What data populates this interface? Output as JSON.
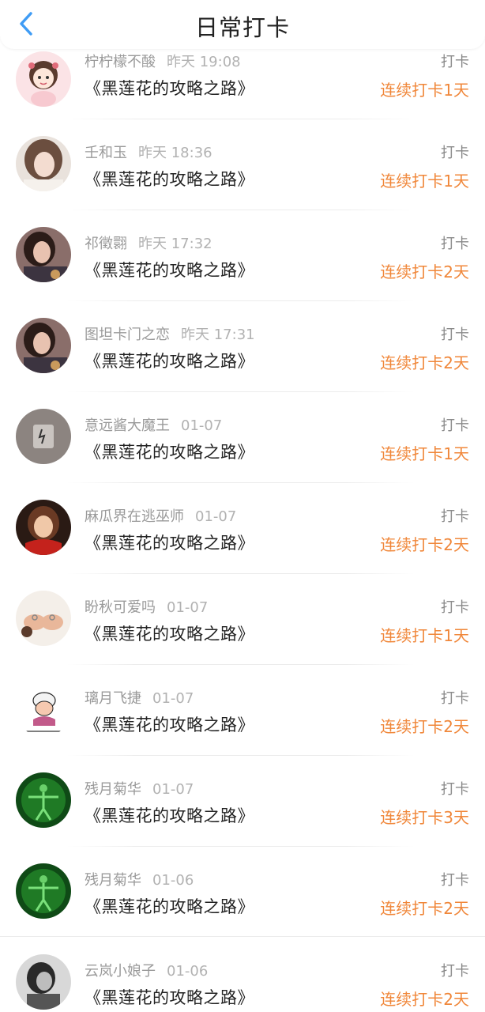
{
  "header": {
    "title": "日常打卡",
    "back_icon": "chevron-left-icon",
    "accent_color": "#3f9cf5"
  },
  "colors": {
    "streak": "#f0873a",
    "name": "#9a9a9a",
    "book": "#222222"
  },
  "entries": [
    {
      "user": "柠柠檬不酸",
      "time": "昨天 19:08",
      "book": "《黑莲花的攻略之路》",
      "type": "打卡",
      "streak": "连续打卡1天",
      "avatar": "cartoon-girl-avatar"
    },
    {
      "user": "壬和玉",
      "time": "昨天 18:36",
      "book": "《黑莲花的攻略之路》",
      "type": "打卡",
      "streak": "连续打卡1天",
      "avatar": "girl-photo-avatar"
    },
    {
      "user": "祁徵翾",
      "time": "昨天 17:32",
      "book": "《黑莲花的攻略之路》",
      "type": "打卡",
      "streak": "连续打卡2天",
      "avatar": "woman-portrait-avatar"
    },
    {
      "user": "图坦卡门之恋",
      "time": "昨天 17:31",
      "book": "《黑莲花的攻略之路》",
      "type": "打卡",
      "streak": "连续打卡2天",
      "avatar": "woman-portrait-avatar"
    },
    {
      "user": "意远酱大魔王",
      "time": "01-07",
      "book": "《黑莲花的攻略之路》",
      "type": "打卡",
      "streak": "连续打卡1天",
      "avatar": "gray-object-avatar"
    },
    {
      "user": "麻瓜界在逃巫师",
      "time": "01-07",
      "book": "《黑莲花的攻略之路》",
      "type": "打卡",
      "streak": "连续打卡2天",
      "avatar": "girl-red-scarf-avatar"
    },
    {
      "user": "盼秋可爱吗",
      "time": "01-07",
      "book": "《黑莲花的攻略之路》",
      "type": "打卡",
      "streak": "连续打卡1天",
      "avatar": "hands-rings-avatar"
    },
    {
      "user": "璃月飞捷",
      "time": "01-07",
      "book": "《黑莲花的攻略之路》",
      "type": "打卡",
      "streak": "连续打卡2天",
      "avatar": "cartoon-swimmer-avatar"
    },
    {
      "user": "残月菊华",
      "time": "01-07",
      "book": "《黑莲花的攻略之路》",
      "type": "打卡",
      "streak": "连续打卡3天",
      "avatar": "green-vitruvian-avatar"
    },
    {
      "user": "残月菊华",
      "time": "01-06",
      "book": "《黑莲花的攻略之路》",
      "type": "打卡",
      "streak": "连续打卡2天",
      "avatar": "green-vitruvian-avatar"
    },
    {
      "user": "云岚小娘子",
      "time": "01-06",
      "book": "《黑莲花的攻略之路》",
      "type": "打卡",
      "streak": "连续打卡2天",
      "avatar": "bw-photo-avatar"
    }
  ]
}
